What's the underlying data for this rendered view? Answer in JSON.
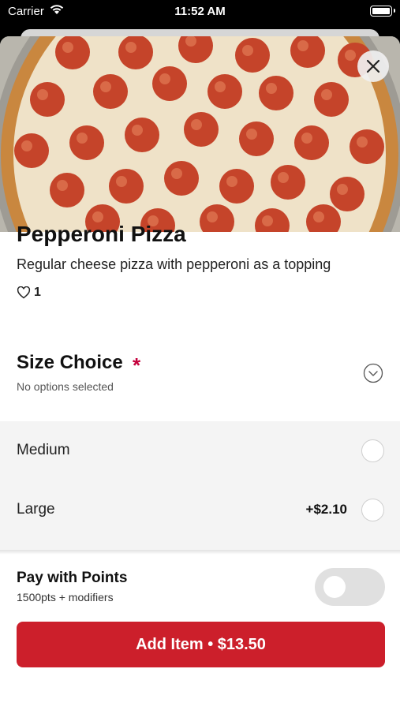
{
  "status_bar": {
    "carrier": "Carrier",
    "time": "11:52 AM",
    "icons": [
      "wifi-icon",
      "battery-icon"
    ]
  },
  "item": {
    "image_alt": "Pepperoni Pizza",
    "title": "Pepperoni Pizza",
    "description": "Regular cheese pizza with pepperoni as a topping",
    "likes": "1"
  },
  "size_section": {
    "title": "Size Choice",
    "required_mark": "*",
    "subtitle": "No options selected",
    "options": [
      {
        "label": "Medium",
        "price": "",
        "selected": false
      },
      {
        "label": "Large",
        "price": "+$2.10",
        "selected": false
      }
    ]
  },
  "points": {
    "title": "Pay with Points",
    "subtitle": "1500pts + modifiers",
    "enabled": false
  },
  "add_button": {
    "label": "Add Item • $13.50"
  },
  "colors": {
    "accent": "#cc1f2b",
    "required": "#c4003c"
  }
}
